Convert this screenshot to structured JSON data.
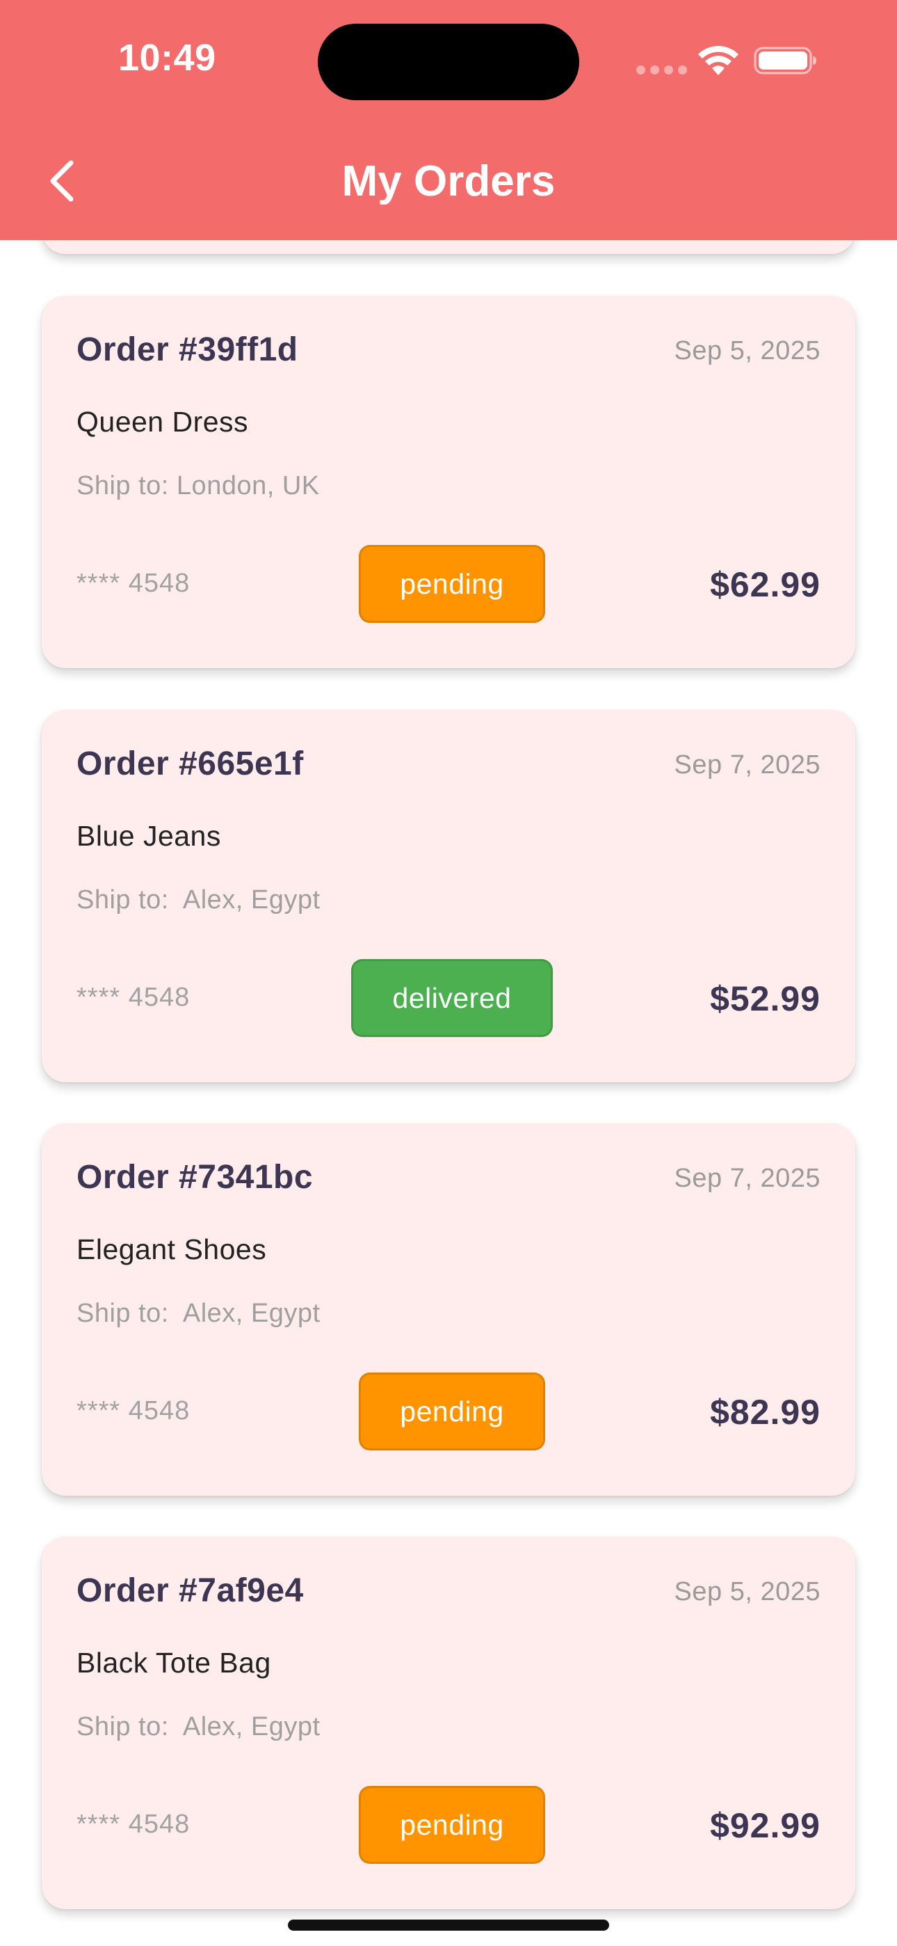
{
  "status_bar": {
    "time": "10:49"
  },
  "header": {
    "title": "My Orders",
    "background": "#f46b6b"
  },
  "icons": {
    "back": "chevron-left-icon",
    "wifi": "wifi-icon",
    "battery": "battery-icon"
  },
  "colors": {
    "pending": "#ff9300",
    "delivered": "#4caf50",
    "card_background": "#ffeded"
  },
  "orders": [
    {
      "id": "Order #39ff1d",
      "date": "Sep 5, 2025",
      "product": "Queen Dress",
      "ship_to": "Ship to: London, UK",
      "card": "**** 4548",
      "status": "pending",
      "total": "$62.99"
    },
    {
      "id": "Order #665e1f",
      "date": "Sep 7, 2025",
      "product": "Blue Jeans",
      "ship_to": "Ship to:  Alex, Egypt",
      "card": "**** 4548",
      "status": "delivered",
      "total": "$52.99"
    },
    {
      "id": "Order #7341bc",
      "date": "Sep 7, 2025",
      "product": "Elegant Shoes",
      "ship_to": "Ship to:  Alex, Egypt",
      "card": "**** 4548",
      "status": "pending",
      "total": "$82.99"
    },
    {
      "id": "Order #7af9e4",
      "date": "Sep 5, 2025",
      "product": "Black Tote Bag",
      "ship_to": "Ship to:  Alex, Egypt",
      "card": "**** 4548",
      "status": "pending",
      "total": "$92.99"
    }
  ]
}
